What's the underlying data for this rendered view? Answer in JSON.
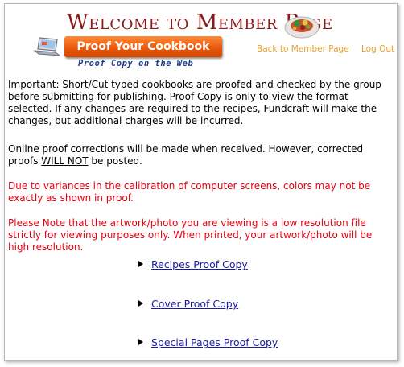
{
  "header": {
    "title_prefix": "Welcome to ",
    "title_rest": "Member Page",
    "proof_button_label": "Proof Your Cookbook",
    "subtitle": "Proof Copy on the Web"
  },
  "nav": {
    "back_label": "Back to Member Page",
    "logout_label": "Log Out"
  },
  "content": {
    "important": "Important: Short/Cut typed cookbooks are proofed and checked by the group before submitting for publishing. Proof Copy is only to view the format selected. If any changes are required to the recipes, Fundcraft will make the changes, but additional charges will be incurred.",
    "online_before": "Online proof corrections will be made when received. However, corrected proofs ",
    "online_emph": "WILL NOT",
    "online_after": " be posted.",
    "calibration": "Due to variances in the calibration of computer screens, colors may not be exactly as shown in proof.",
    "resolution": "Please Note that the artwork/photo you are viewing is a low resolution file strictly for viewing purposes only. When printed, your artwork/photo will be high resolution."
  },
  "links": [
    {
      "label": "Recipes Proof Copy"
    },
    {
      "label": "Cover Proof Copy"
    },
    {
      "label": "Special Pages Proof Copy"
    }
  ],
  "colors": {
    "title": "#8b1a1a",
    "button": "#e8560a",
    "subtitle": "#1f3d8c",
    "top_links": "#e6a033",
    "notice": "#e4000f",
    "link": "#1a1aa6"
  }
}
